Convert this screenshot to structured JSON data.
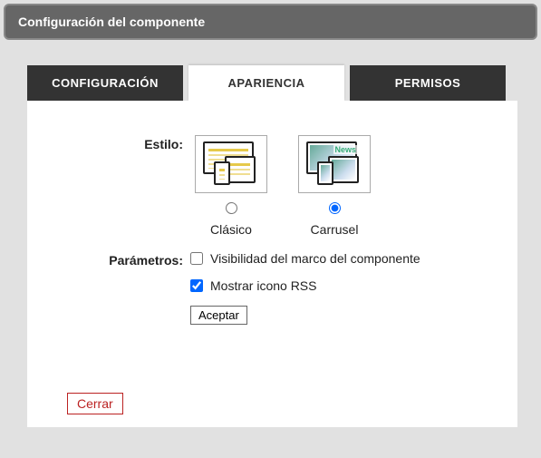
{
  "dialog": {
    "title": "Configuración del componente"
  },
  "tabs": {
    "config": "CONFIGURACIÓN",
    "appearance": "APARIENCIA",
    "permissions": "PERMISOS"
  },
  "labels": {
    "style": "Estilo:",
    "params": "Parámetros:"
  },
  "styles": {
    "classic": {
      "label": "Clásico",
      "news_text": ""
    },
    "carousel": {
      "label": "Carrusel",
      "news_text": "News"
    }
  },
  "params": {
    "frame_visibility": "Visibilidad del marco del componente",
    "show_rss": "Mostrar icono RSS"
  },
  "buttons": {
    "accept": "Aceptar",
    "close": "Cerrar"
  }
}
